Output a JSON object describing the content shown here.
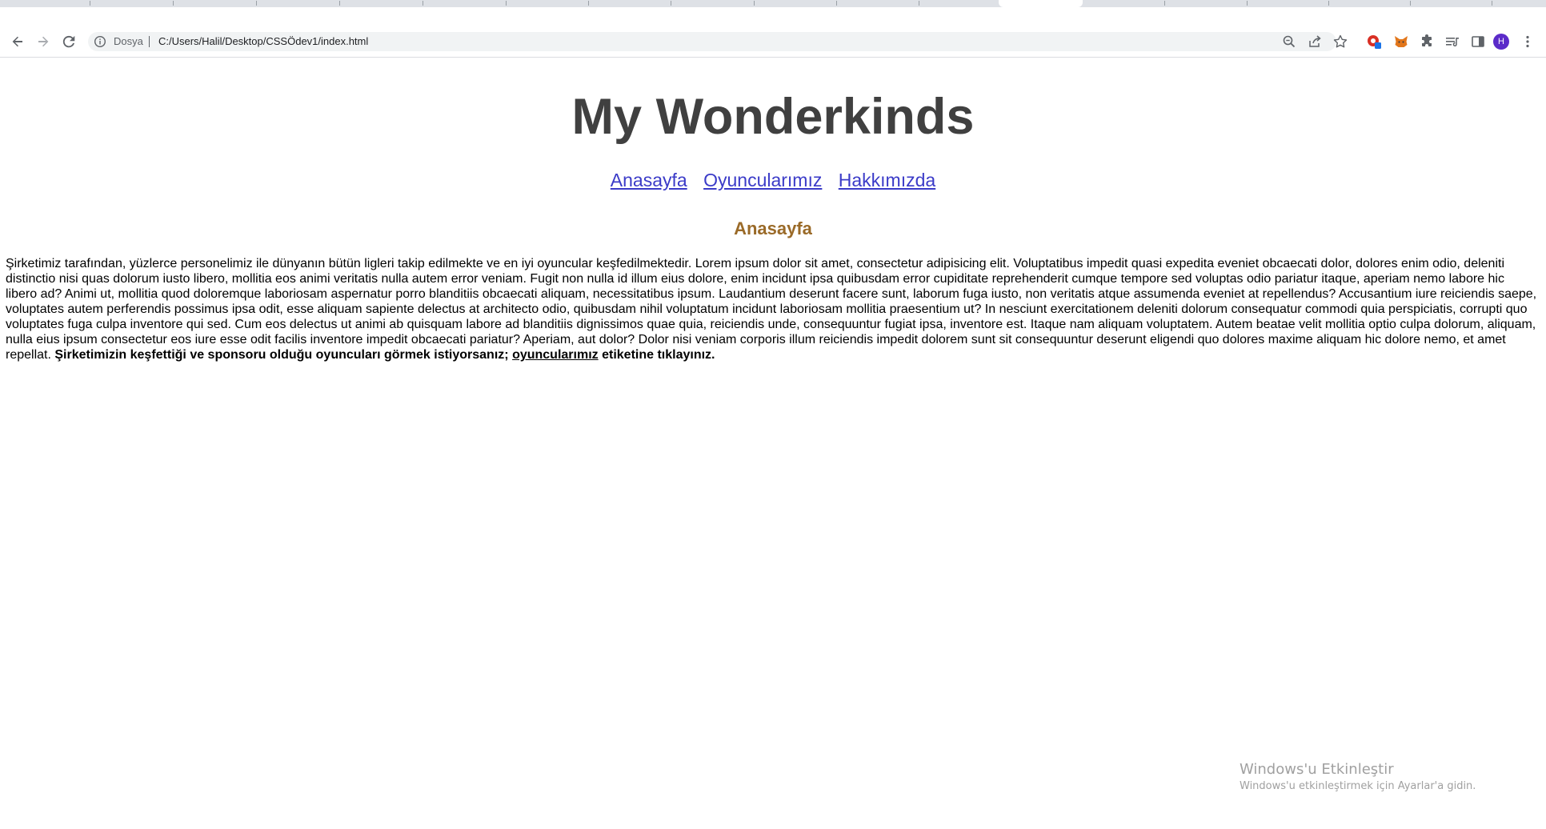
{
  "browser": {
    "scheme_label": "Dosya",
    "url": "C:/Users/Halil/Desktop/CSSÖdev1/index.html",
    "profile_initial": "H",
    "icons": {
      "back": "arrow-left-icon",
      "forward": "arrow-right-icon",
      "reload": "reload-icon",
      "info": "info-icon",
      "zoom": "zoom-icon",
      "share": "share-icon",
      "bookmark": "star-icon",
      "extensions": [
        "record-extension-icon",
        "metamask-fox-icon",
        "puzzle-icon",
        "reading-list-icon",
        "side-panel-icon"
      ],
      "menu": "kebab-menu-icon"
    }
  },
  "site": {
    "title": "My Wonderkinds",
    "nav": {
      "home": "Anasayfa",
      "players": "Oyuncularımız",
      "about": "Hakkımızda"
    },
    "section_title": "Anasayfa",
    "paragraph_text": "Şirketimiz tarafından, yüzlerce personelimiz ile dünyanın bütün ligleri takip edilmekte ve en iyi oyuncular keşfedilmektedir. Lorem ipsum dolor sit amet, consectetur adipisicing elit. Voluptatibus impedit quasi expedita eveniet obcaecati dolor, dolores enim odio, deleniti distinctio nisi quas dolorum iusto libero, mollitia eos animi veritatis nulla autem error veniam. Fugit non nulla id illum eius dolore, enim incidunt ipsa quibusdam error cupiditate reprehenderit cumque tempore sed voluptas odio pariatur itaque, aperiam nemo labore hic libero ad? Animi ut, mollitia quod doloremque laboriosam aspernatur porro blanditiis obcaecati aliquam, necessitatibus ipsum. Laudantium deserunt facere sunt, laborum fuga iusto, non veritatis atque assumenda eveniet at repellendus? Accusantium iure reiciendis saepe, voluptates autem perferendis possimus ipsa odit, esse aliquam sapiente delectus at architecto odio, quibusdam nihil voluptatum incidunt laboriosam mollitia praesentium ut? In nesciunt exercitationem deleniti dolorum consequatur commodi quia perspiciatis, corrupti quo voluptates fuga culpa inventore qui sed. Cum eos delectus ut animi ab quisquam labore ad blanditiis dignissimos quae quia, reiciendis unde, consequuntur fugiat ipsa, inventore est. Itaque nam aliquam voluptatem. Autem beatae velit mollitia optio culpa dolorum, aliquam, nulla eius ipsum consectetur eos iure esse odit facilis inventore impedit obcaecati pariatur? Aperiam, aut dolor? Dolor nisi veniam corporis illum reiciendis impedit dolorem sunt sit consequuntur deserunt eligendi quo dolores maxime aliquam hic dolore nemo, et amet repellat.",
    "cta_before": "Şirketimizin keşfettiği ve sponsoru olduğu oyuncuları görmek istiyorsanız;",
    "cta_link": "oyuncularımız",
    "cta_after": "etiketine tıklayınız."
  },
  "os_watermark": {
    "line1": "Windows'u Etkinleştir",
    "line2": "Windows'u etkinleştirmek için Ayarlar'a gidin."
  },
  "colors": {
    "title": "#404040",
    "nav_link": "#3b3bc8",
    "section_title": "#9a6a28",
    "tabstrip": "#dee1e6",
    "omnibox": "#f1f3f4",
    "avatar": "#5b2bc9"
  }
}
